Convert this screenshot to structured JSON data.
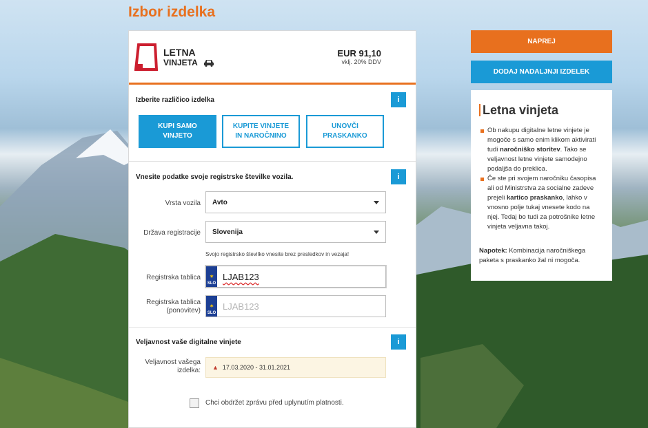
{
  "page": {
    "title": "Izbor izdelka"
  },
  "product": {
    "name_line1": "LETNA",
    "name_line2": "VINJETA",
    "price": "EUR 91,10",
    "price_note": "vklj. 20% DDV",
    "icon": "vignette-logo-icon",
    "vehicle_icon": "car-icon"
  },
  "variant_section": {
    "title": "Izberite različico izdelka",
    "info_label": "i",
    "options": [
      {
        "label": "KUPI SAMO VINJETO",
        "active": true
      },
      {
        "label": "KUPITE VINJETE IN NAROČNINO",
        "active": false
      },
      {
        "label": "UNOVČI PRASKANKO",
        "active": false
      }
    ]
  },
  "registration_section": {
    "title": "Vnesite podatke svoje registrske številke vozila.",
    "info_label": "i",
    "vehicle_type": {
      "label": "Vrsta vozila",
      "value": "Avto"
    },
    "country": {
      "label": "Država registracije",
      "value": "Slovenija"
    },
    "hint": "Svojo registrsko številko vnesite brez presledkov in vezaja!",
    "plate": {
      "label": "Registrska tablica",
      "value": "LJAB123",
      "country_code": "SLO"
    },
    "plate_repeat": {
      "label_line1": "Registrska tablica",
      "label_line2": "(ponovitev)",
      "placeholder": "LJAB123",
      "country_code": "SLO"
    }
  },
  "validity_section": {
    "title": "Veljavnost vaše digitalne vinjete",
    "info_label": "i",
    "label_line1": "Veljavnost vašega",
    "label_line2": "izdelka:",
    "value": "17.03.2020 - 31.01.2021",
    "checkbox_label": "Chci obdržet zprávu před uplynutím platnosti."
  },
  "actions": {
    "next": "NAPREJ",
    "add_product": "DODAJ NADALJNJI IZDELEK"
  },
  "side_panel": {
    "title": "Letna vinjeta",
    "item1_a": "Ob nakupu digitalne letne vinjete je mogoče s samo enim klikom aktivirati tudi ",
    "item1_bold": "naročniško storitev",
    "item1_b": ". Tako se veljavnost letne vinjete samodejno podaljša do preklica.",
    "item2_a": "Če ste pri svojem naročniku časopisa ali od Ministrstva za socialne zadeve prejeli ",
    "item2_bold": "kartico praskanko",
    "item2_b": ", lahko v vnosno polje tukaj vnesete kodo na njej. Tedaj bo tudi za potrošnike letne vinjeta veljavna takoj.",
    "note_bold": "Napotek:",
    "note_text": " Kombinacija naročniškega paketa s praskanko žal ni mogoča."
  },
  "colors": {
    "accent_orange": "#e8701e",
    "accent_blue": "#1a9ad6"
  }
}
